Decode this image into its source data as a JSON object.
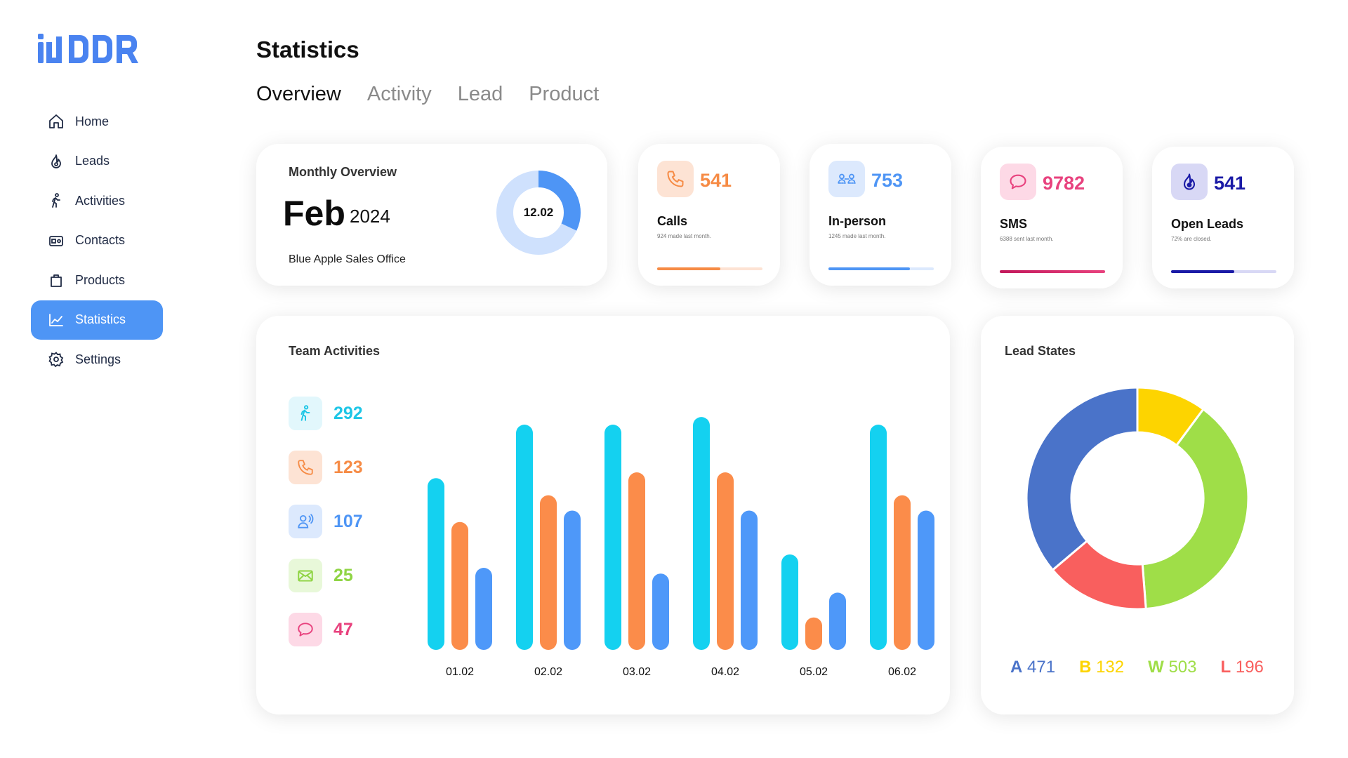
{
  "logo_text": "iDDR",
  "sidebar": {
    "items": [
      {
        "label": "Home",
        "icon": "home-icon"
      },
      {
        "label": "Leads",
        "icon": "flame-icon"
      },
      {
        "label": "Activities",
        "icon": "walking-icon"
      },
      {
        "label": "Contacts",
        "icon": "contact-card-icon"
      },
      {
        "label": "Products",
        "icon": "bag-icon"
      },
      {
        "label": "Statistics",
        "icon": "chart-icon",
        "active": true
      },
      {
        "label": "Settings",
        "icon": "gear-icon"
      }
    ]
  },
  "header": {
    "title": "Statistics",
    "tabs": [
      {
        "label": "Overview",
        "active": true
      },
      {
        "label": "Activity"
      },
      {
        "label": "Lead"
      },
      {
        "label": "Product"
      }
    ]
  },
  "monthly": {
    "label": "Monthly Overview",
    "month": "Feb",
    "year": "2024",
    "office": "Blue Apple Sales Office",
    "donut_value": "12.02",
    "donut_fraction": 0.32,
    "colors": {
      "fill": "#4e95f5",
      "track": "#cfe1fd"
    }
  },
  "stats": [
    {
      "value": "541",
      "label": "Calls",
      "sub": "924 made last month.",
      "icon": "phone-icon",
      "color": "#f68b45",
      "bg": "#fde3d4",
      "track": "#fde3d4",
      "progress": 0.6
    },
    {
      "value": "753",
      "label": "In-person",
      "sub": "1245 made last month.",
      "icon": "people-icon",
      "color": "#4e95f5",
      "bg": "#dce9fd",
      "track": "#dce9fd",
      "progress": 0.77
    },
    {
      "value": "9782",
      "label": "SMS",
      "sub": "6388 sent last month.",
      "icon": "chat-bubble-icon",
      "color": "#e8427e",
      "bg": "#fdd9e6",
      "track": "#f4c9d6",
      "progress": 1.0
    },
    {
      "value": "541",
      "label": "Open Leads",
      "sub": "72% are closed.",
      "icon": "flame-icon",
      "color": "#1a1aa6",
      "bg": "#d8d8f5",
      "track": "#d8d8f5",
      "progress": 0.6
    }
  ],
  "team": {
    "label": "Team Activities",
    "metrics": [
      {
        "value": "292",
        "icon": "walking-icon",
        "color": "#1ec6e6",
        "bg": "#e2f7fc"
      },
      {
        "value": "123",
        "icon": "phone-icon",
        "color": "#f68b45",
        "bg": "#fde3d4"
      },
      {
        "value": "107",
        "icon": "person-voice-icon",
        "color": "#4e95f5",
        "bg": "#dce9fd"
      },
      {
        "value": "25",
        "icon": "mail-icon",
        "color": "#8fd444",
        "bg": "#e8f8d9"
      },
      {
        "value": "47",
        "icon": "chat-bubble-icon",
        "color": "#e8427e",
        "bg": "#fdd9e6"
      }
    ]
  },
  "chart_data": [
    {
      "type": "bar",
      "categories": [
        "01.02",
        "02.02",
        "03.02",
        "04.02",
        "05.02",
        "06.02"
      ],
      "series": [
        {
          "values": [
            90,
            118,
            118,
            122,
            50,
            118
          ],
          "color": "#14d1f0"
        },
        {
          "values": [
            67,
            81,
            93,
            93,
            17,
            81
          ],
          "color": "#fb8c4a"
        },
        {
          "values": [
            43,
            73,
            40,
            73,
            30,
            73
          ],
          "color": "#4e98f9"
        }
      ],
      "ylim": [
        0,
        125
      ]
    },
    {
      "type": "pie",
      "title": "Lead States",
      "categories": [
        "A",
        "B",
        "W",
        "L"
      ],
      "values": [
        471,
        132,
        503,
        196
      ],
      "colors": [
        "#4a73c9",
        "#fdd400",
        "#9fde48",
        "#f95f5e"
      ],
      "slices_order": [
        "B",
        "W",
        "L",
        "A"
      ],
      "legend": [
        {
          "key": "A",
          "value": "471",
          "color": "#4a73c9"
        },
        {
          "key": "B",
          "value": "132",
          "color": "#fdd400"
        },
        {
          "key": "W",
          "value": "503",
          "color": "#9fde48"
        },
        {
          "key": "L",
          "value": "196",
          "color": "#f95f5e"
        }
      ]
    }
  ]
}
